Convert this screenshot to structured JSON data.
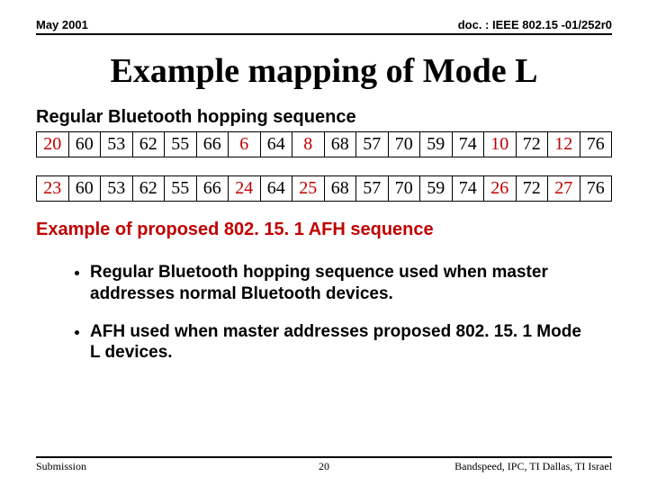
{
  "header": {
    "left": "May 2001",
    "right": "doc. : IEEE 802.15 -01/252r0"
  },
  "title": "Example mapping of Mode L",
  "regular_label": "Regular Bluetooth hopping sequence",
  "seq1": [
    {
      "v": "20",
      "r": true
    },
    {
      "v": "60"
    },
    {
      "v": "53"
    },
    {
      "v": "62"
    },
    {
      "v": "55"
    },
    {
      "v": "66"
    },
    {
      "v": "6",
      "r": true
    },
    {
      "v": "64"
    },
    {
      "v": "8",
      "r": true
    },
    {
      "v": "68"
    },
    {
      "v": "57"
    },
    {
      "v": "70"
    },
    {
      "v": "59"
    },
    {
      "v": "74"
    },
    {
      "v": "10",
      "r": true
    },
    {
      "v": "72"
    },
    {
      "v": "12",
      "r": true
    },
    {
      "v": "76"
    }
  ],
  "seq2": [
    {
      "v": "23",
      "r": true
    },
    {
      "v": "60"
    },
    {
      "v": "53"
    },
    {
      "v": "62"
    },
    {
      "v": "55"
    },
    {
      "v": "66"
    },
    {
      "v": "24",
      "r": true
    },
    {
      "v": "64"
    },
    {
      "v": "25",
      "r": true
    },
    {
      "v": "68"
    },
    {
      "v": "57"
    },
    {
      "v": "70"
    },
    {
      "v": "59"
    },
    {
      "v": "74"
    },
    {
      "v": "26",
      "r": true
    },
    {
      "v": "72"
    },
    {
      "v": "27",
      "r": true
    },
    {
      "v": "76"
    }
  ],
  "afhead": "Example of proposed 802. 15. 1 AFH sequence",
  "bullets": [
    "Regular Bluetooth hopping sequence used when master addresses normal Bluetooth devices.",
    "AFH used when master addresses proposed 802. 15. 1 Mode L devices."
  ],
  "footer": {
    "left": "Submission",
    "center": "20",
    "right": "Bandspeed, IPC, TI Dallas, TI Israel"
  }
}
